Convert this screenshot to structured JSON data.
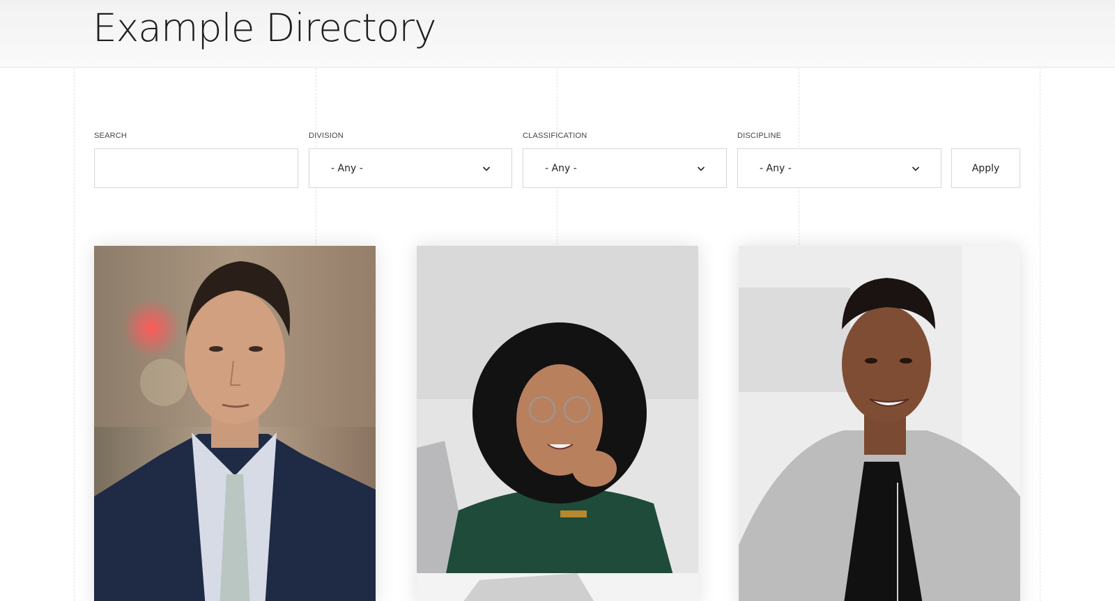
{
  "header": {
    "title": "Example Directory"
  },
  "filters": {
    "search": {
      "label": "SEARCH",
      "value": "",
      "placeholder": ""
    },
    "division": {
      "label": "DIVISION",
      "selected": "- Any -"
    },
    "classification": {
      "label": "CLASSIFICATION",
      "selected": "- Any -"
    },
    "discipline": {
      "label": "DISCIPLINE",
      "selected": "- Any -"
    },
    "apply_label": "Apply"
  },
  "profiles": [
    {
      "photo": "portrait-man-navy-suit"
    },
    {
      "photo": "portrait-woman-curly-hair-glasses"
    },
    {
      "photo": "portrait-woman-grey-blazer"
    }
  ]
}
